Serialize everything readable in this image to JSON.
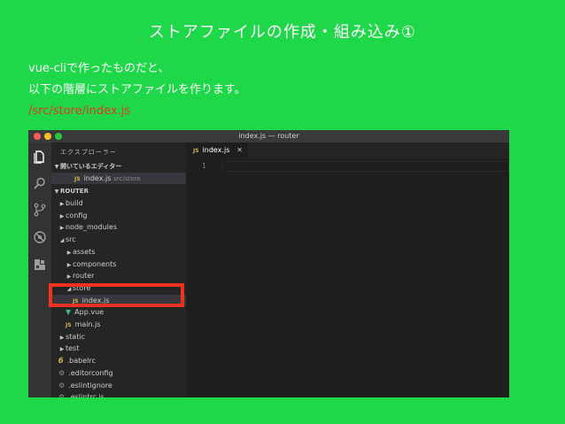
{
  "slide": {
    "title": "ストアファイルの作成・組み込み①",
    "line1": "vue-cliで作ったものだと、",
    "line2": "以下の階層にストアファイルを作ります。",
    "path": "/src/store/index.js"
  },
  "window": {
    "title": "index.js — router"
  },
  "activity_bar": [
    "files-icon",
    "search-icon",
    "source-control-icon",
    "debug-icon",
    "extensions-icon"
  ],
  "sidebar": {
    "header": "エクスプローラー",
    "open_editors_label": "開いているエディター",
    "open_editor_file": "index.js",
    "open_editor_path": "src/store",
    "project_label": "ROUTER",
    "tree": [
      {
        "label": "build",
        "type": "folder-closed",
        "indent": 1
      },
      {
        "label": "config",
        "type": "folder-closed",
        "indent": 1
      },
      {
        "label": "node_modules",
        "type": "folder-closed",
        "indent": 1
      },
      {
        "label": "src",
        "type": "folder-open",
        "indent": 1
      },
      {
        "label": "assets",
        "type": "folder-closed",
        "indent": 2
      },
      {
        "label": "components",
        "type": "folder-closed",
        "indent": 2
      },
      {
        "label": "router",
        "type": "folder-closed",
        "indent": 2
      },
      {
        "label": "store",
        "type": "folder-open",
        "indent": 2
      },
      {
        "label": "index.js",
        "type": "js",
        "indent": 3,
        "selected": true
      },
      {
        "label": "App.vue",
        "type": "vue",
        "indent": 2
      },
      {
        "label": "main.js",
        "type": "js",
        "indent": 2
      },
      {
        "label": "static",
        "type": "folder-closed",
        "indent": 1
      },
      {
        "label": "test",
        "type": "folder-closed",
        "indent": 1
      },
      {
        "label": ".babelrc",
        "type": "babel",
        "indent": 1
      },
      {
        "label": ".editorconfig",
        "type": "gear",
        "indent": 1
      },
      {
        "label": ".eslintignore",
        "type": "gear",
        "indent": 1
      },
      {
        "label": ".eslintrc.js",
        "type": "gear",
        "indent": 1
      }
    ]
  },
  "editor": {
    "tab_label": "index.js",
    "js_badge": "JS",
    "close_glyph": "✕",
    "line_number": "1"
  },
  "colors": {
    "slide_bg": "#1fd84a",
    "path_text": "#e03a1e",
    "highlight": "#f0321e"
  }
}
